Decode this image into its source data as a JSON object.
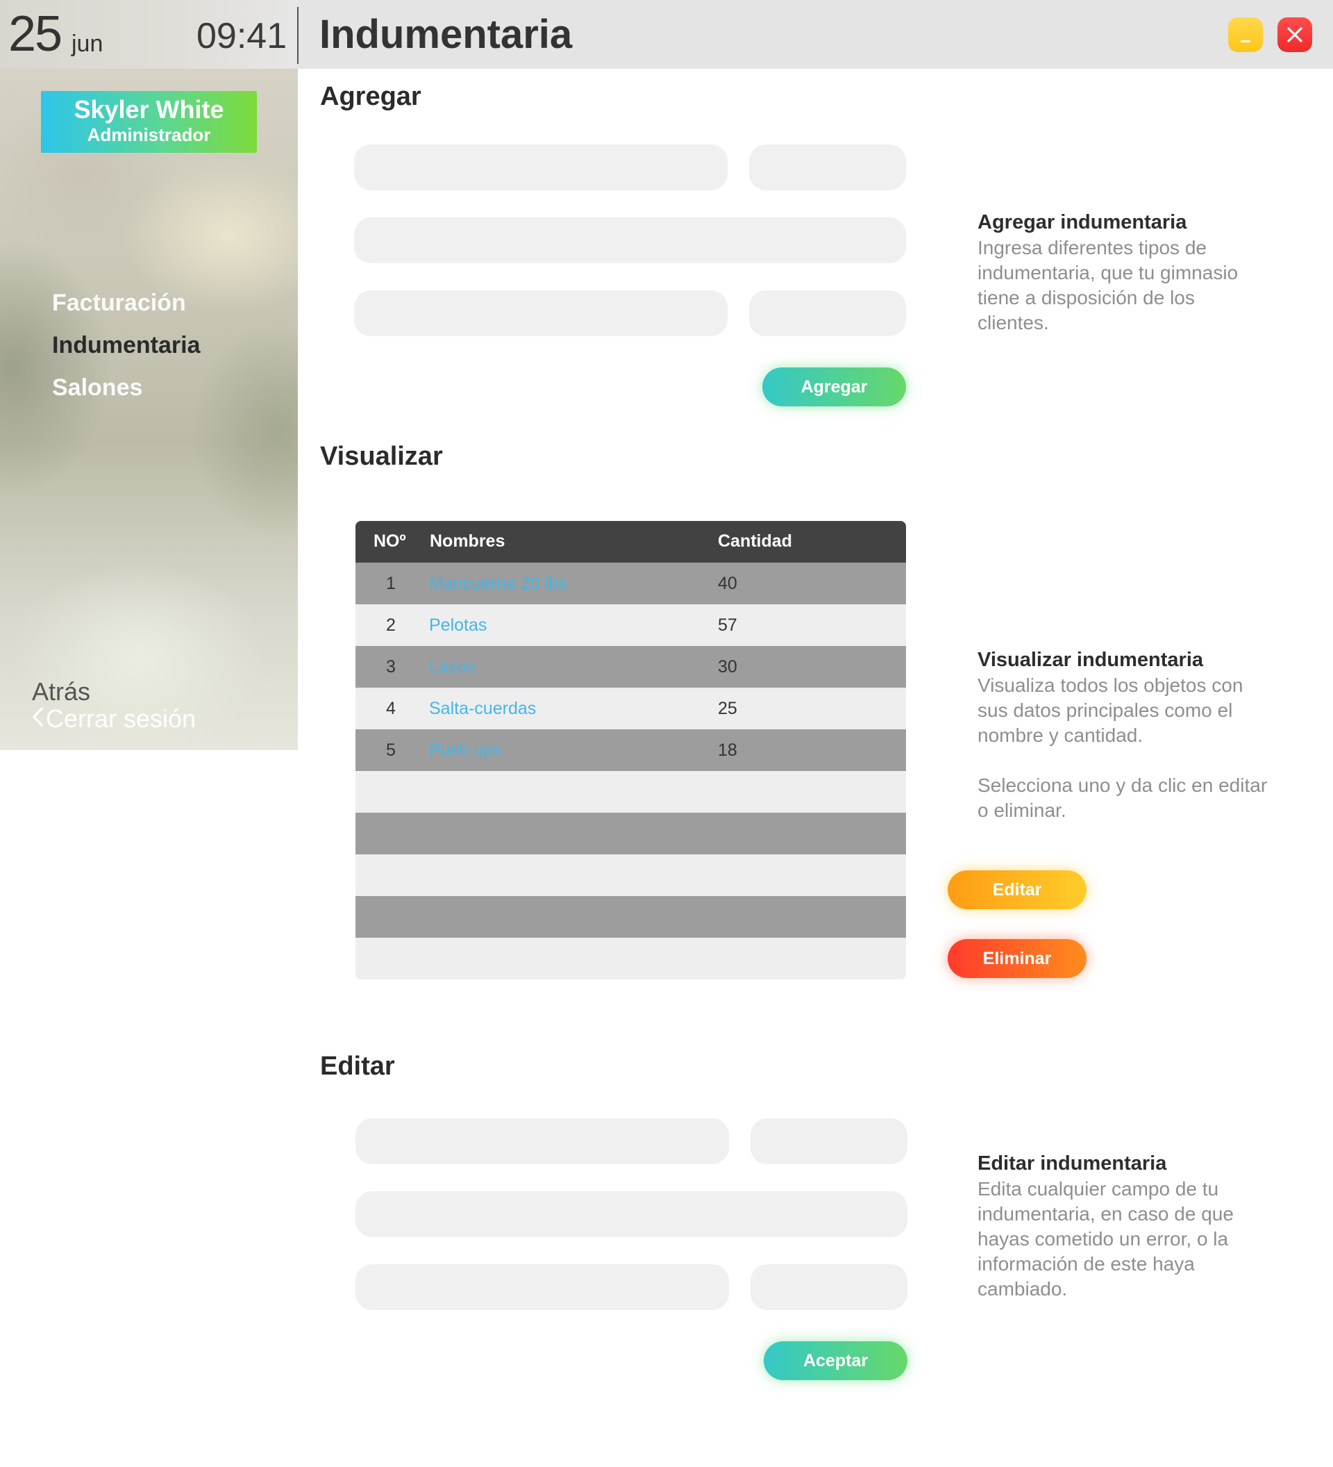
{
  "header": {
    "day": "25",
    "month": "jun",
    "time": "09:41",
    "title": "Indumentaria"
  },
  "sidebar": {
    "user_name": "Skyler White",
    "user_role": "Administrador",
    "items": [
      {
        "label": "Facturación"
      },
      {
        "label": "Indumentaria"
      },
      {
        "label": "Salones"
      }
    ],
    "active_item": "Indumentaria",
    "back_label": "Atrás",
    "logout_label": "Cerrar sesión"
  },
  "add_section": {
    "title": "Agregar",
    "button": "Agregar",
    "info_title": "Agregar indumentaria",
    "info_text": "Ingresa diferentes tipos de indumentaria, que tu gimnasio tiene a disposición de los clientes."
  },
  "view_section": {
    "title": "Visualizar",
    "columns": [
      "NOº",
      "Nombres",
      "Cantidad"
    ],
    "rows": [
      {
        "num": "1",
        "name": "Mancuerna 20 lbs",
        "qty": "40"
      },
      {
        "num": "2",
        "name": "Pelotas",
        "qty": "57"
      },
      {
        "num": "3",
        "name": "Lazos",
        "qty": "30"
      },
      {
        "num": "4",
        "name": "Salta-cuerdas",
        "qty": "25"
      },
      {
        "num": "5",
        "name": "Push ups",
        "qty": "18"
      }
    ],
    "info_title": "Visualizar indumentaria",
    "info_text_1": "Visualiza todos los objetos con sus datos principales como el nombre y cantidad.",
    "info_text_2": "Selecciona uno y da clic en editar o eliminar.",
    "edit_button": "Editar",
    "delete_button": "Eliminar"
  },
  "edit_section": {
    "title": "Editar",
    "button": "Aceptar",
    "info_title": "Editar indumentaria",
    "info_text": "Edita cualquier campo de tu indumentaria, en caso de que hayas cometido un error, o la información de este haya cambiado."
  },
  "colors": {
    "accent_green": "#5ad696",
    "accent_blue": "#2ec5ea",
    "link_blue": "#43b6e8",
    "warning": "#ffb81e",
    "danger": "#ff3b2b"
  }
}
